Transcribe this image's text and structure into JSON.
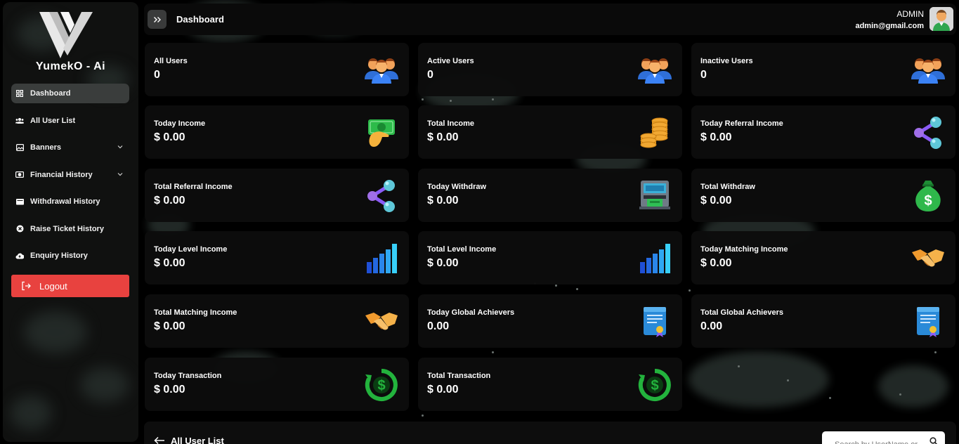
{
  "app": {
    "brand": "YumekO - Ai"
  },
  "sidebar": {
    "items": [
      {
        "label": "Dashboard",
        "icon": "grid-icon",
        "active": true,
        "has_chevron": false
      },
      {
        "label": "All User List",
        "icon": "users-icon",
        "active": false,
        "has_chevron": false
      },
      {
        "label": "Banners",
        "icon": "image-icon",
        "active": false,
        "has_chevron": true
      },
      {
        "label": "Financial History",
        "icon": "money-icon",
        "active": false,
        "has_chevron": true
      },
      {
        "label": "Withdrawal History",
        "icon": "wallet-icon",
        "active": false,
        "has_chevron": false
      },
      {
        "label": "Raise Ticket History",
        "icon": "x-circle-icon",
        "active": false,
        "has_chevron": false
      },
      {
        "label": "Enquiry History",
        "icon": "cloud-upload-icon",
        "active": false,
        "has_chevron": false
      }
    ],
    "logout_label": "Logout"
  },
  "header": {
    "title": "Dashboard",
    "admin_name": "ADMIN",
    "admin_email": "admin@gmail.com"
  },
  "cards": [
    {
      "label": "All Users",
      "value": "0",
      "icon": "users-group-icon"
    },
    {
      "label": "Active Users",
      "value": "0",
      "icon": "users-group-icon"
    },
    {
      "label": "Inactive Users",
      "value": "0",
      "icon": "users-group-icon"
    },
    {
      "label": "Today Income",
      "value": "$ 0.00",
      "icon": "cash-hand-icon"
    },
    {
      "label": "Total Income",
      "value": "$ 0.00",
      "icon": "coins-icon"
    },
    {
      "label": "Today Referral Income",
      "value": "$ 0.00",
      "icon": "share-nodes-icon"
    },
    {
      "label": "Total Referral Income",
      "value": "$ 0.00",
      "icon": "share-nodes-icon"
    },
    {
      "label": "Today Withdraw",
      "value": "$ 0.00",
      "icon": "atm-icon"
    },
    {
      "label": "Total Withdraw",
      "value": "$ 0.00",
      "icon": "money-bag-icon"
    },
    {
      "label": "Today Level Income",
      "value": "$ 0.00",
      "icon": "bar-chart-icon"
    },
    {
      "label": "Total Level Income",
      "value": "$ 0.00",
      "icon": "bar-chart-icon"
    },
    {
      "label": "Today Matching Income",
      "value": "$ 0.00",
      "icon": "handshake-icon"
    },
    {
      "label": "Total Matching Income",
      "value": "$ 0.00",
      "icon": "handshake-icon"
    },
    {
      "label": "Today Global Achievers",
      "value": "0.00",
      "icon": "certificate-icon"
    },
    {
      "label": "Total Global Achievers",
      "value": "0.00",
      "icon": "certificate-icon"
    },
    {
      "label": "Today Transaction",
      "value": "$ 0.00",
      "icon": "dollar-refresh-icon"
    },
    {
      "label": "Total Transaction",
      "value": "$ 0.00",
      "icon": "dollar-refresh-icon"
    }
  ],
  "user_list": {
    "title": "All User List",
    "search_placeholder": "Search by UserName or..."
  }
}
